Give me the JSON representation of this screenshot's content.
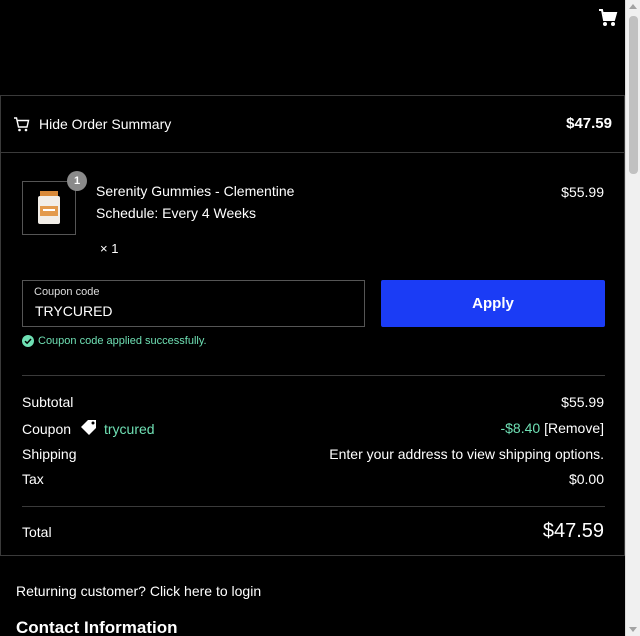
{
  "colors": {
    "background": "#000000",
    "accent_button": "#1b3cf5",
    "success": "#6fe0b4",
    "border": "#3a3a3a"
  },
  "header": {
    "cart_icon": "cart-icon"
  },
  "summary": {
    "toggle_label": "Hide Order Summary",
    "header_total": "$47.59",
    "product": {
      "quantity_badge": "1",
      "name": "Serenity Gummies - Clementine",
      "schedule": "Schedule: Every 4 Weeks",
      "price": "$55.99",
      "quantity": "× 1"
    },
    "coupon": {
      "label": "Coupon code",
      "value": "TRYCURED",
      "apply_label": "Apply",
      "success_message": "Coupon code applied successfully."
    },
    "totals": {
      "subtotal_label": "Subtotal",
      "subtotal_value": "$55.99",
      "coupon_label": "Coupon",
      "coupon_code": "trycured",
      "coupon_discount": "-$8.40",
      "coupon_remove": "[Remove]",
      "shipping_label": "Shipping",
      "shipping_value": "Enter your address to view shipping options.",
      "tax_label": "Tax",
      "tax_value": "$0.00",
      "total_label": "Total",
      "total_value": "$47.59"
    }
  },
  "footer": {
    "returning_customer": "Returning customer? Click here to login",
    "contact_title": "Contact Information"
  }
}
